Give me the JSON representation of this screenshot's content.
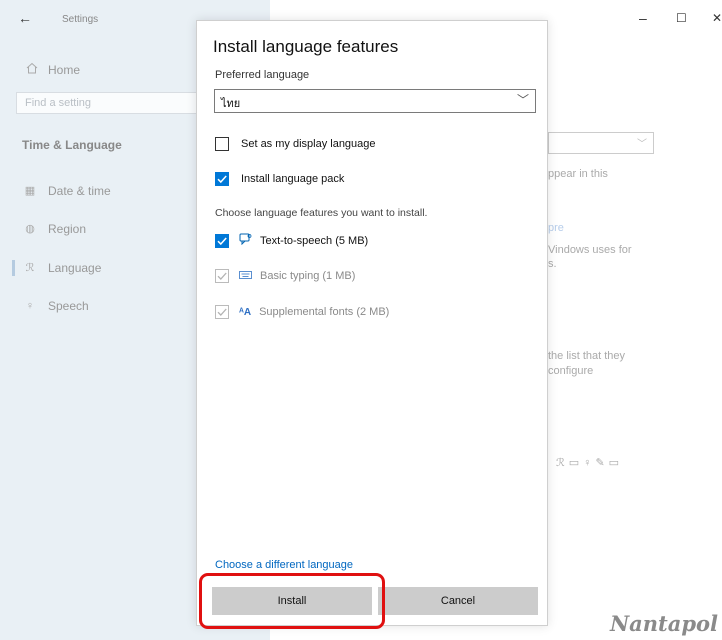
{
  "settings": {
    "back_icon": "back-arrow-icon",
    "app_title": "Settings",
    "home_label": "Home",
    "search_placeholder": "Find a setting",
    "section_title": "Time & Language",
    "nav": [
      {
        "label": "Date & time",
        "icon": "calendar-clock-icon"
      },
      {
        "label": "Region",
        "icon": "globe-icon"
      },
      {
        "label": "Language",
        "icon": "language-icon"
      },
      {
        "label": "Speech",
        "icon": "microphone-icon"
      }
    ],
    "active_nav": "Language",
    "window_controls": {
      "minimize": "–",
      "maximize": "☐",
      "close": "✕"
    },
    "bg_fragments": {
      "line1": "ppear in this",
      "link": "pre",
      "line2": "Vindows uses for",
      "line3": "s.",
      "line4": "the list that they",
      "line5": "configure"
    }
  },
  "dialog": {
    "title": "Install language features",
    "preferred_label": "Preferred language",
    "preferred_value": "ไทย",
    "options": [
      {
        "label": "Set as my display language",
        "state": "unchecked"
      },
      {
        "label": "Install language pack",
        "state": "checked"
      }
    ],
    "features_heading": "Choose language features you want to install.",
    "features": [
      {
        "label": "Text-to-speech (5 MB)",
        "state": "checked",
        "icon": "speech-bubble-icon"
      },
      {
        "label": "Basic typing (1 MB)",
        "state": "checked-disabled",
        "icon": "keyboard-icon"
      },
      {
        "label": "Supplemental fonts (2 MB)",
        "state": "checked-disabled",
        "icon": "font-aa-icon"
      }
    ],
    "different_language_link": "Choose a different language",
    "install_button": "Install",
    "cancel_button": "Cancel"
  },
  "watermark": "Nantapol",
  "colors": {
    "accent": "#0078d7",
    "link": "#0067c0",
    "highlight": "#e01010",
    "sidebar": "#e9f0f5"
  }
}
